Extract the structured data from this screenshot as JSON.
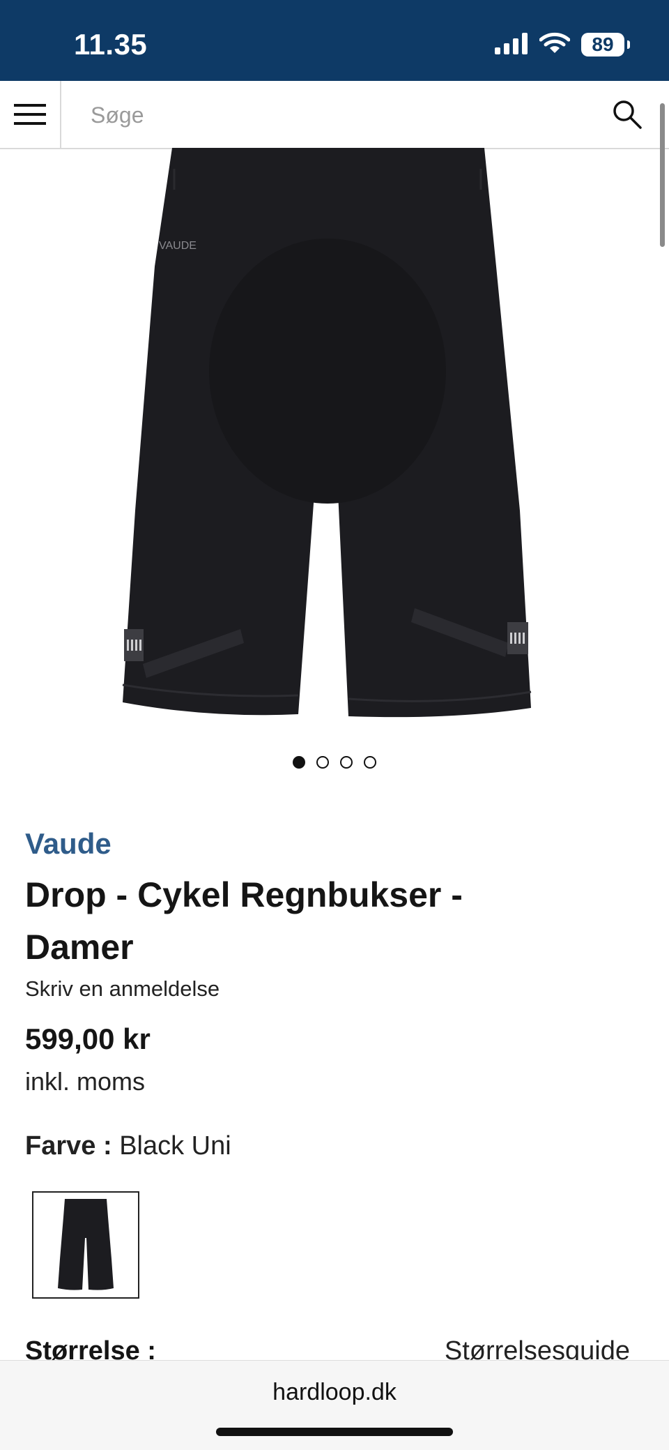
{
  "status": {
    "time": "11.35",
    "battery": "89"
  },
  "search": {
    "placeholder": "Søge"
  },
  "product": {
    "brand": "Vaude",
    "title": "Drop - Cykel Regnbukser - Damer",
    "review_link": "Skriv en anmeldelse",
    "price": "599,00 kr",
    "vat_note": "inkl. moms",
    "color_label": "Farve :",
    "color_value": "Black Uni",
    "size_label": "Størrelse :",
    "size_guide": "Størrelsesguide",
    "image_brand_mark": "VAUDE",
    "carousel": {
      "count": 4,
      "active": 1
    }
  },
  "browser": {
    "url": "hardloop.dk"
  },
  "colors": {
    "status_bar": "#0e3a66",
    "brand": "#2f5c8a"
  },
  "icons": [
    "menu-icon",
    "search-icon",
    "signal-icon",
    "wifi-icon",
    "battery-icon"
  ]
}
